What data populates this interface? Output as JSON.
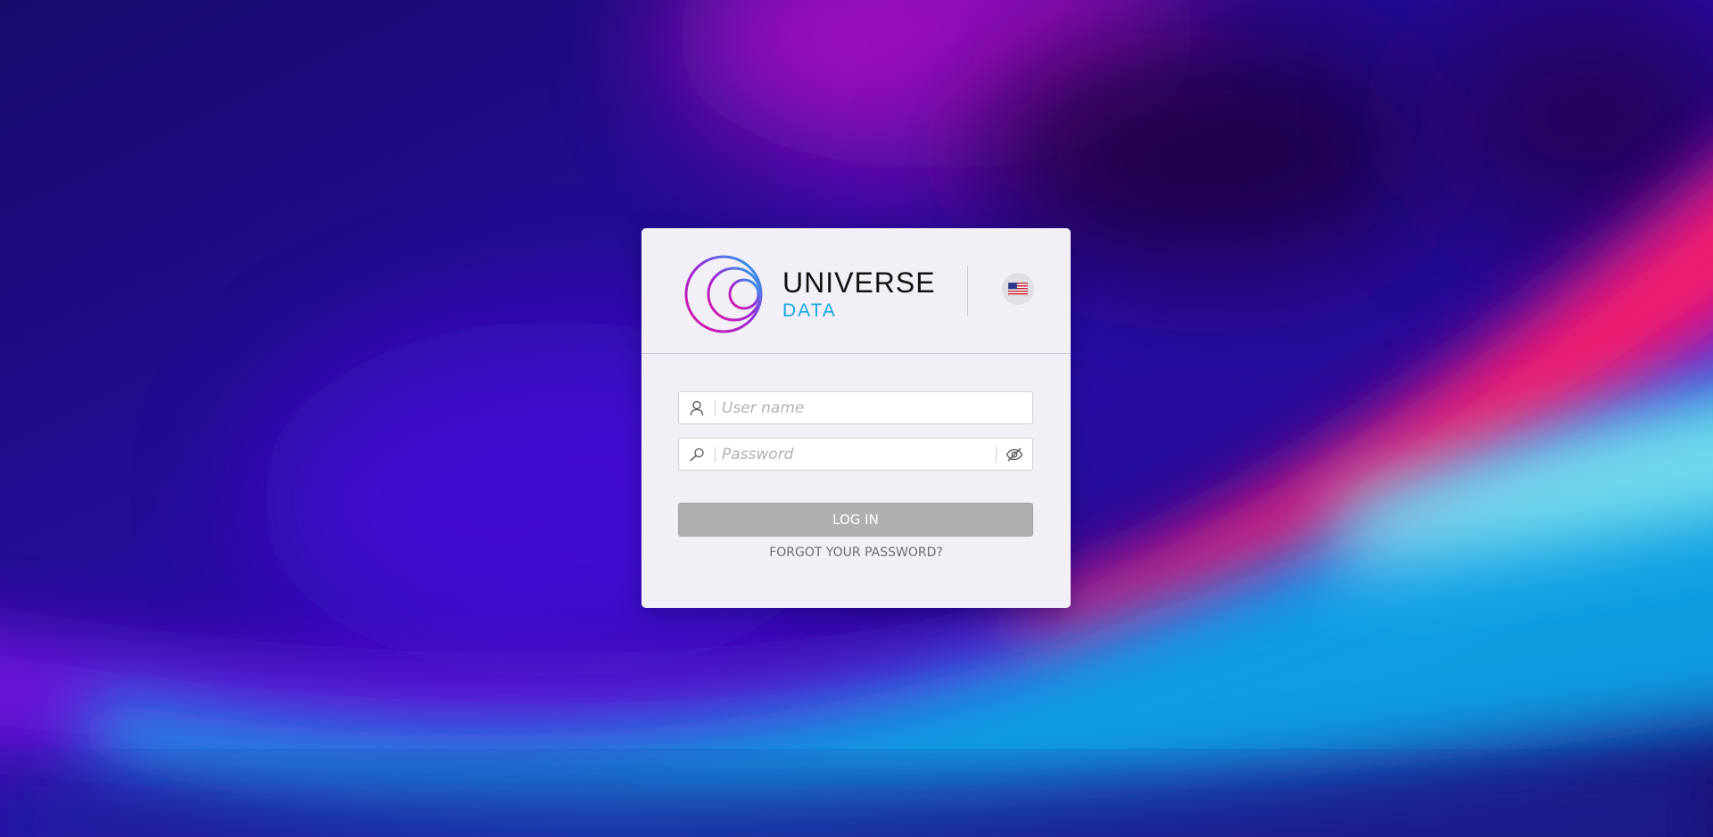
{
  "brand": {
    "name": "UNIVERSE",
    "sub": "DATA"
  },
  "language": {
    "icon": "us-flag-icon"
  },
  "form": {
    "username": {
      "placeholder": "User name",
      "value": "",
      "icon": "user-icon"
    },
    "password": {
      "placeholder": "Password",
      "value": "",
      "icon": "key-icon",
      "toggle_icon": "eye-slash-icon"
    },
    "login_label": "LOG IN",
    "forgot_label": "FORGOT YOUR PASSWORD?"
  },
  "colors": {
    "card_bg": "#f2f0f6",
    "brand_accent": "#16a8e6",
    "logo_gradient_start": "#e0189e",
    "logo_gradient_end": "#18b4ee",
    "button_disabled": "#b0b0b0"
  }
}
